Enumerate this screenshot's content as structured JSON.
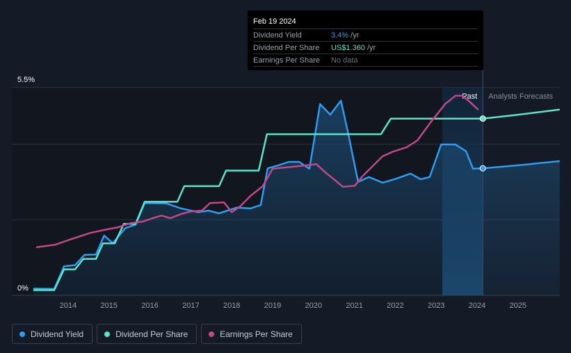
{
  "tooltip": {
    "date": "Feb 19 2024",
    "rows": [
      {
        "label": "Dividend Yield",
        "value": "3.4%",
        "unit": " /yr",
        "color": "#2e9cf0"
      },
      {
        "label": "Dividend Per Share",
        "value": "US$1.360",
        "unit": " /yr",
        "color": "#5ee3c8"
      },
      {
        "label": "Earnings Per Share",
        "value": "No data",
        "unit": "",
        "color": "#6b717a"
      }
    ]
  },
  "labels": {
    "past": "Past",
    "forecast": "Analysts Forecasts"
  },
  "legend": [
    {
      "label": "Dividend Yield",
      "color": "#2e9cf0"
    },
    {
      "label": "Dividend Per Share",
      "color": "#5ee3c8"
    },
    {
      "label": "Earnings Per Share",
      "color": "#c2488a"
    }
  ],
  "chart_data": {
    "type": "line",
    "xlim": [
      2013,
      2026
    ],
    "ylim": [
      0,
      5.5
    ],
    "y_ticks": [
      "0%",
      "5.5%"
    ],
    "x_ticks": [
      2014,
      2015,
      2016,
      2017,
      2018,
      2019,
      2020,
      2021,
      2022,
      2023,
      2024,
      2025
    ],
    "past_band_start": 2023.15,
    "forecast_start": 2024.14,
    "series": [
      {
        "name": "Dividend Yield",
        "unit": "%",
        "color": "#2e9cf0",
        "points": [
          [
            2013.15,
            0.18
          ],
          [
            2013.66,
            0.17
          ],
          [
            2013.9,
            0.77
          ],
          [
            2014.17,
            0.8
          ],
          [
            2014.4,
            1.07
          ],
          [
            2014.68,
            1.08
          ],
          [
            2014.88,
            1.58
          ],
          [
            2015.09,
            1.38
          ],
          [
            2015.4,
            1.78
          ],
          [
            2015.65,
            1.87
          ],
          [
            2015.87,
            2.44
          ],
          [
            2016.41,
            2.43
          ],
          [
            2016.76,
            2.3
          ],
          [
            2017.18,
            2.2
          ],
          [
            2017.43,
            2.24
          ],
          [
            2017.69,
            2.17
          ],
          [
            2018.12,
            2.32
          ],
          [
            2018.46,
            2.3
          ],
          [
            2018.71,
            2.39
          ],
          [
            2018.88,
            3.36
          ],
          [
            2019.14,
            3.44
          ],
          [
            2019.39,
            3.53
          ],
          [
            2019.65,
            3.53
          ],
          [
            2019.9,
            3.35
          ],
          [
            2020.16,
            5.06
          ],
          [
            2020.41,
            4.78
          ],
          [
            2020.67,
            5.15
          ],
          [
            2020.84,
            4.32
          ],
          [
            2021.09,
            3.0
          ],
          [
            2021.35,
            3.13
          ],
          [
            2021.69,
            2.98
          ],
          [
            2022.03,
            3.09
          ],
          [
            2022.37,
            3.22
          ],
          [
            2022.62,
            3.07
          ],
          [
            2022.84,
            3.13
          ],
          [
            2023.12,
            3.99
          ],
          [
            2023.47,
            3.99
          ],
          [
            2023.73,
            3.81
          ],
          [
            2023.9,
            3.35
          ],
          [
            2024.14,
            3.36
          ],
          [
            2025,
            3.44
          ],
          [
            2026.02,
            3.55
          ]
        ]
      },
      {
        "name": "Dividend Per Share",
        "unit": "US$",
        "color": "#5ee3c8",
        "points": [
          [
            2013.15,
            0.04
          ],
          [
            2013.66,
            0.04
          ],
          [
            2013.9,
            0.2
          ],
          [
            2014.17,
            0.2
          ],
          [
            2014.37,
            0.28
          ],
          [
            2014.68,
            0.28
          ],
          [
            2014.85,
            0.4
          ],
          [
            2015.14,
            0.4
          ],
          [
            2015.36,
            0.55
          ],
          [
            2015.65,
            0.55
          ],
          [
            2015.87,
            0.72
          ],
          [
            2016.67,
            0.72
          ],
          [
            2016.84,
            0.84
          ],
          [
            2017.69,
            0.84
          ],
          [
            2017.86,
            0.96
          ],
          [
            2018.66,
            0.96
          ],
          [
            2018.86,
            1.24
          ],
          [
            2021.65,
            1.24
          ],
          [
            2021.89,
            1.36
          ],
          [
            2024.14,
            1.36
          ],
          [
            2025,
            1.39
          ],
          [
            2026.02,
            1.43
          ]
        ]
      },
      {
        "name": "Earnings Per Share",
        "unit": "index",
        "color": "#c2488a",
        "points": [
          [
            2013.22,
            1.27
          ],
          [
            2013.69,
            1.34
          ],
          [
            2014.03,
            1.47
          ],
          [
            2014.54,
            1.65
          ],
          [
            2014.88,
            1.73
          ],
          [
            2015.22,
            1.8
          ],
          [
            2015.53,
            1.91
          ],
          [
            2015.82,
            1.95
          ],
          [
            2016.07,
            2.04
          ],
          [
            2016.28,
            2.11
          ],
          [
            2016.5,
            2.04
          ],
          [
            2016.76,
            2.15
          ],
          [
            2017.01,
            2.22
          ],
          [
            2017.27,
            2.24
          ],
          [
            2017.47,
            2.44
          ],
          [
            2017.81,
            2.46
          ],
          [
            2018.0,
            2.2
          ],
          [
            2018.2,
            2.35
          ],
          [
            2018.46,
            2.63
          ],
          [
            2018.76,
            2.89
          ],
          [
            2019.0,
            3.35
          ],
          [
            2019.48,
            3.4
          ],
          [
            2019.82,
            3.44
          ],
          [
            2020.07,
            3.47
          ],
          [
            2020.29,
            3.25
          ],
          [
            2020.5,
            3.07
          ],
          [
            2020.72,
            2.87
          ],
          [
            2021.01,
            2.9
          ],
          [
            2021.18,
            3.13
          ],
          [
            2021.43,
            3.4
          ],
          [
            2021.69,
            3.68
          ],
          [
            2021.94,
            3.8
          ],
          [
            2022.28,
            3.92
          ],
          [
            2022.54,
            4.1
          ],
          [
            2022.88,
            4.6
          ],
          [
            2023.22,
            5.06
          ],
          [
            2023.47,
            5.28
          ],
          [
            2023.64,
            5.28
          ],
          [
            2023.81,
            5.13
          ],
          [
            2024.03,
            4.91
          ]
        ]
      }
    ]
  }
}
